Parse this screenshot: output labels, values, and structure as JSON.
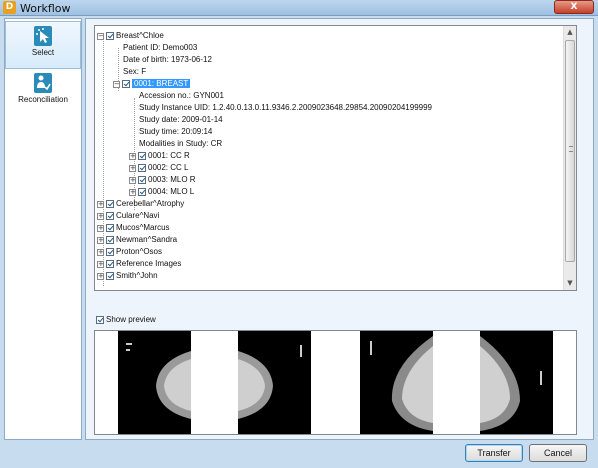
{
  "window": {
    "title": "Workflow",
    "app_icon_letter": "D",
    "close_glyph": "X"
  },
  "sidebar": {
    "items": [
      {
        "label": "Select",
        "icon": "cursor-select-icon"
      },
      {
        "label": "Reconciliation",
        "icon": "reconciliation-icon"
      }
    ]
  },
  "tree": {
    "patient": {
      "name": "Breast^Chloe",
      "details": [
        "Patient ID: Demo003",
        "Date of birth: 1973-06-12",
        "Sex: F"
      ],
      "study": {
        "label": "0001: BREAST",
        "details": [
          "Accession no.: GYN001",
          "Study Instance UID: 1.2.40.0.13.0.11.9346.2.2009023648.29854.20090204199999",
          "Study date: 2009-01-14",
          "Study time: 20:09:14",
          "Modalities in Study: CR"
        ],
        "series": [
          "0001: CC R",
          "0002: CC L",
          "0003: MLO R",
          "0004: MLO L"
        ]
      }
    },
    "others": [
      "Cerebellar^Atrophy",
      "Culare^Navi",
      "Mucos^Marcus",
      "Newman^Sandra",
      "Proton^Osos",
      "Reference Images",
      "Smith^John"
    ]
  },
  "preview": {
    "show_label": "Show preview",
    "show_checked": true
  },
  "buttons": {
    "transfer": "Transfer",
    "cancel": "Cancel"
  },
  "colors": {
    "selection": "#3399ff",
    "frame": "#c7dcef"
  }
}
